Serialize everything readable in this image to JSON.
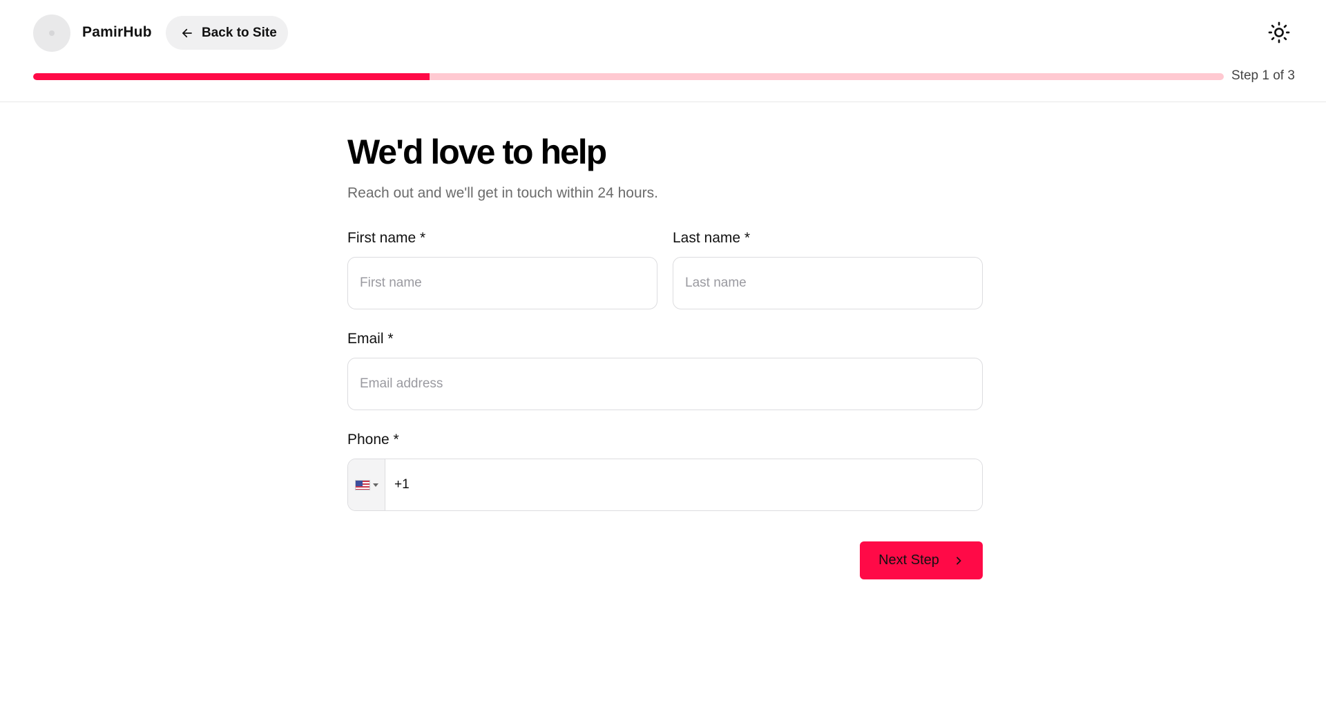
{
  "header": {
    "brand": "PamirHub",
    "back_label": "Back to Site",
    "step_text": "Step 1 of 3",
    "progress_fraction": 0.333,
    "icons": {
      "back": "arrow-left-icon",
      "theme": "sun-icon",
      "logo": "logo-placeholder"
    }
  },
  "main": {
    "title": "We'd love to help",
    "subtitle": "Reach out and we'll get in touch within 24 hours.",
    "first_name": {
      "label": "First name *",
      "placeholder": "First name",
      "value": ""
    },
    "last_name": {
      "label": "Last name *",
      "placeholder": "Last name",
      "value": ""
    },
    "email": {
      "label": "Email *",
      "placeholder": "Email address",
      "value": ""
    },
    "phone": {
      "label": "Phone *",
      "country": "US",
      "flag_icon": "us-flag-icon",
      "value": "+1"
    },
    "next_label": "Next Step",
    "next_icon": "chevron-right-icon"
  },
  "colors": {
    "accent": "#ff0a47",
    "progress_track": "#ffc9d1",
    "subtitle": "#6b6b6b",
    "border": "#dcdcdf"
  }
}
